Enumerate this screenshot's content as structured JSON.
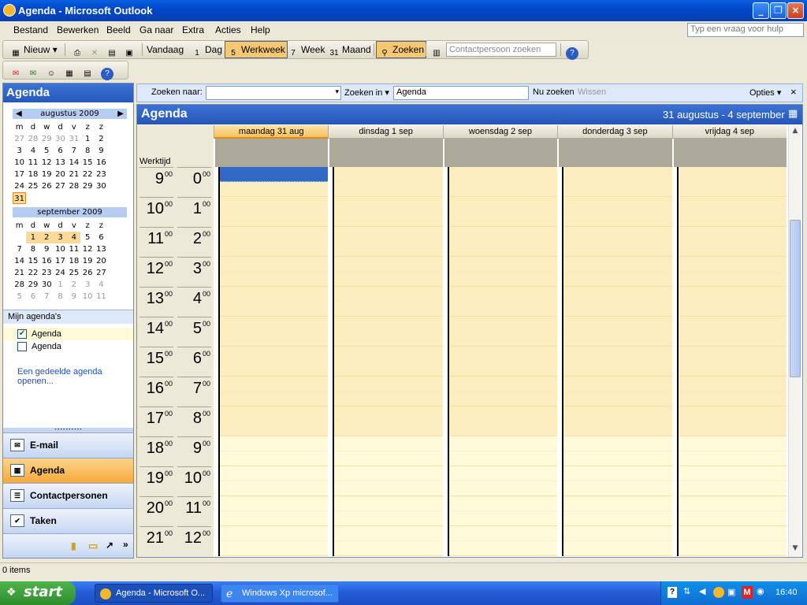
{
  "window": {
    "title": "Agenda - Microsoft Outlook",
    "minimize": "_",
    "restore": "❐",
    "close": "×"
  },
  "menu": [
    "Bestand",
    "Bewerken",
    "Beeld",
    "Ga naar",
    "Extra",
    "Acties",
    "Help"
  ],
  "help_placeholder": "Typ een vraag voor hulp",
  "toolbar": {
    "new": "Nieuw",
    "today": "Vandaag",
    "day": "Dag",
    "day_icon": "1",
    "workweek": "Werkweek",
    "workweek_icon": "5",
    "week": "Week",
    "week_icon": "7",
    "month": "Maand",
    "month_icon": "31",
    "search": "Zoeken",
    "contact_search_placeholder": "Contactpersoon zoeken"
  },
  "nav": {
    "title": "Agenda",
    "cal1": {
      "month": "augustus 2009",
      "weekdays": [
        "m",
        "d",
        "w",
        "d",
        "v",
        "z",
        "z"
      ],
      "days": [
        {
          "d": "27",
          "c": "dim"
        },
        {
          "d": "28",
          "c": "dim"
        },
        {
          "d": "29",
          "c": "dim"
        },
        {
          "d": "30",
          "c": "dim"
        },
        {
          "d": "31",
          "c": "dim"
        },
        {
          "d": "1",
          "c": ""
        },
        {
          "d": "2",
          "c": ""
        },
        {
          "d": "3",
          "c": ""
        },
        {
          "d": "4",
          "c": ""
        },
        {
          "d": "5",
          "c": ""
        },
        {
          "d": "6",
          "c": ""
        },
        {
          "d": "7",
          "c": ""
        },
        {
          "d": "8",
          "c": ""
        },
        {
          "d": "9",
          "c": ""
        },
        {
          "d": "10",
          "c": ""
        },
        {
          "d": "11",
          "c": ""
        },
        {
          "d": "12",
          "c": ""
        },
        {
          "d": "13",
          "c": ""
        },
        {
          "d": "14",
          "c": ""
        },
        {
          "d": "15",
          "c": ""
        },
        {
          "d": "16",
          "c": ""
        },
        {
          "d": "17",
          "c": ""
        },
        {
          "d": "18",
          "c": ""
        },
        {
          "d": "19",
          "c": ""
        },
        {
          "d": "20",
          "c": ""
        },
        {
          "d": "21",
          "c": ""
        },
        {
          "d": "22",
          "c": ""
        },
        {
          "d": "23",
          "c": ""
        },
        {
          "d": "24",
          "c": ""
        },
        {
          "d": "25",
          "c": ""
        },
        {
          "d": "26",
          "c": ""
        },
        {
          "d": "27",
          "c": ""
        },
        {
          "d": "28",
          "c": ""
        },
        {
          "d": "29",
          "c": ""
        },
        {
          "d": "30",
          "c": ""
        },
        {
          "d": "31",
          "c": "today"
        }
      ]
    },
    "cal2": {
      "month": "september 2009",
      "weekdays": [
        "m",
        "d",
        "w",
        "d",
        "v",
        "z",
        "z"
      ],
      "days": [
        {
          "d": "",
          "c": ""
        },
        {
          "d": "1",
          "c": "wk"
        },
        {
          "d": "2",
          "c": "wk"
        },
        {
          "d": "3",
          "c": "wk"
        },
        {
          "d": "4",
          "c": "wk"
        },
        {
          "d": "5",
          "c": ""
        },
        {
          "d": "6",
          "c": ""
        },
        {
          "d": "7",
          "c": ""
        },
        {
          "d": "8",
          "c": ""
        },
        {
          "d": "9",
          "c": ""
        },
        {
          "d": "10",
          "c": ""
        },
        {
          "d": "11",
          "c": ""
        },
        {
          "d": "12",
          "c": ""
        },
        {
          "d": "13",
          "c": ""
        },
        {
          "d": "14",
          "c": ""
        },
        {
          "d": "15",
          "c": ""
        },
        {
          "d": "16",
          "c": ""
        },
        {
          "d": "17",
          "c": ""
        },
        {
          "d": "18",
          "c": ""
        },
        {
          "d": "19",
          "c": ""
        },
        {
          "d": "20",
          "c": ""
        },
        {
          "d": "21",
          "c": ""
        },
        {
          "d": "22",
          "c": ""
        },
        {
          "d": "23",
          "c": ""
        },
        {
          "d": "24",
          "c": ""
        },
        {
          "d": "25",
          "c": ""
        },
        {
          "d": "26",
          "c": ""
        },
        {
          "d": "27",
          "c": ""
        },
        {
          "d": "28",
          "c": ""
        },
        {
          "d": "29",
          "c": ""
        },
        {
          "d": "30",
          "c": ""
        },
        {
          "d": "1",
          "c": "dim"
        },
        {
          "d": "2",
          "c": "dim"
        },
        {
          "d": "3",
          "c": "dim"
        },
        {
          "d": "4",
          "c": "dim"
        },
        {
          "d": "5",
          "c": "dim"
        },
        {
          "d": "6",
          "c": "dim"
        },
        {
          "d": "7",
          "c": "dim"
        },
        {
          "d": "8",
          "c": "dim"
        },
        {
          "d": "9",
          "c": "dim"
        },
        {
          "d": "10",
          "c": "dim"
        },
        {
          "d": "11",
          "c": "dim"
        }
      ]
    },
    "my_calendars": "Mijn agenda's",
    "calendars": [
      {
        "name": "Agenda",
        "checked": true
      },
      {
        "name": "Agenda",
        "checked": false
      }
    ],
    "open_shared": "Een gedeelde agenda openen...",
    "buttons": [
      {
        "label": "E-mail",
        "icon": "mail-icon",
        "active": false
      },
      {
        "label": "Agenda",
        "icon": "calendar-icon",
        "active": true
      },
      {
        "label": "Contactpersonen",
        "icon": "contacts-icon",
        "active": false
      },
      {
        "label": "Taken",
        "icon": "tasks-icon",
        "active": false
      }
    ]
  },
  "searchbar": {
    "search_for": "Zoeken naar:",
    "search_in": "Zoeken in",
    "search_in_value": "Agenda",
    "search_now": "Nu zoeken",
    "clear": "Wissen",
    "options": "Opties"
  },
  "main": {
    "title": "Agenda",
    "range": "31 augustus - 4 september",
    "worktime": "Werktijd",
    "days": [
      "maandag 31 aug",
      "dinsdag 1 sep",
      "woensdag 2 sep",
      "donderdag 3 sep",
      "vrijdag 4 sep"
    ],
    "hours_left": [
      "9",
      "10",
      "11",
      "12",
      "13",
      "14",
      "15",
      "16",
      "17",
      "18",
      "19",
      "20",
      "21"
    ],
    "hours_right": [
      "0",
      "1",
      "2",
      "3",
      "4",
      "5",
      "6",
      "7",
      "8",
      "9",
      "10",
      "11",
      "12"
    ],
    "minutes": "00",
    "work_hours_rows": 9,
    "colors": {
      "work": "#fdeebf",
      "offwork": "#fffbd9",
      "selected": "#3169c6"
    }
  },
  "status": "0 items",
  "taskbar": {
    "start": "start",
    "tasks": [
      "Agenda - Microsoft O...",
      "Windows Xp microsof..."
    ],
    "time": "16:40"
  }
}
